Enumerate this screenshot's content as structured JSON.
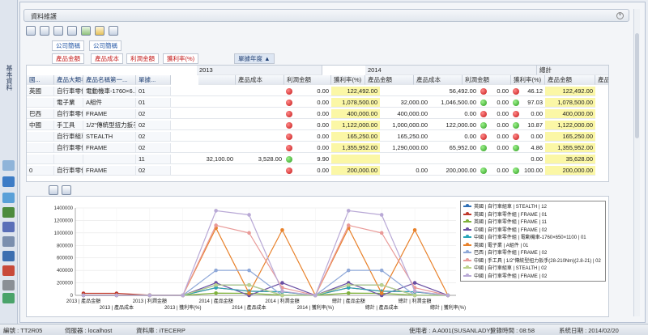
{
  "rail": {
    "tab_label": "基本資料"
  },
  "panel": {
    "title": "資料維護"
  },
  "filters": {
    "company_abbr": "公司簡稱",
    "company_code": "公司簡稱"
  },
  "data_fields": [
    "產品金額",
    "產品成本",
    "利潤金額",
    "獲利率(%)"
  ],
  "column_field": "單據年度",
  "row_fields": [
    "國...",
    "產品大類名...",
    "產品名稱第一...",
    "單據..."
  ],
  "years": [
    "2013",
    "2014"
  ],
  "total_label": "總計",
  "measure_headers": [
    "產品成本",
    "利潤金額",
    "獲利率(%)",
    "產品金額"
  ],
  "rows": [
    {
      "c0": "英國",
      "c1": "自行車零件組",
      "c2": "電動機車-1760×6...",
      "c3": "01",
      "y13": [
        "",
        "",
        "red",
        "0.00"
      ],
      "y14a": "122,492.00",
      "y14": [
        "",
        "56,492.00",
        "red",
        "0.00"
      ],
      "tot": [
        "",
        "",
        "red",
        "46.12"
      ],
      "tot_amt": "122,492.00"
    },
    {
      "c0": "",
      "c1": "電子業",
      "c2": "A組件",
      "c3": "01",
      "y13": [
        "",
        "",
        "red",
        "0.00"
      ],
      "y14a": "1,078,500.00",
      "y14": [
        "32,000.00",
        "1,046,500.00",
        "green",
        "0.00"
      ],
      "tot": [
        "",
        "",
        "green",
        "97.03"
      ],
      "tot_amt": "1,078,500.00"
    },
    {
      "c0": "巴西",
      "c1": "自行車零件組",
      "c2": "FRAME",
      "c3": "02",
      "y13": [
        "",
        "",
        "red",
        "0.00"
      ],
      "y14a": "400,000.00",
      "y14": [
        "400,000.00",
        "0.00",
        "red",
        "0.00"
      ],
      "tot": [
        "",
        "",
        "red",
        "0.00"
      ],
      "tot_amt": "400,000.00"
    },
    {
      "c0": "中國",
      "c1": "手工具",
      "c2": "1/2\"傳統型扭力扳手",
      "c3": "02",
      "y13": [
        "",
        "",
        "red",
        "0.00"
      ],
      "y14a": "1,122,000.00",
      "y14": [
        "1,000,000.00",
        "122,000.00",
        "green",
        "0.00"
      ],
      "tot": [
        "",
        "",
        "green",
        "10.87"
      ],
      "tot_amt": "1,122,000.00"
    },
    {
      "c0": "",
      "c1": "自行車組車",
      "c2": "STEALTH",
      "c3": "02",
      "y13": [
        "",
        "",
        "red",
        "0.00"
      ],
      "y14a": "165,250.00",
      "y14": [
        "165,250.00",
        "0.00",
        "red",
        "0.00"
      ],
      "tot": [
        "",
        "",
        "red",
        "0.00"
      ],
      "tot_amt": "165,250.00"
    },
    {
      "c0": "",
      "c1": "自行車零件組",
      "c2": "FRAME",
      "c3": "02",
      "y13": [
        "",
        "",
        "red",
        "0.00"
      ],
      "y14a": "1,355,952.00",
      "y14": [
        "1,290,000.00",
        "65,952.00",
        "green",
        "0.00"
      ],
      "tot": [
        "",
        "",
        "green",
        "4.86"
      ],
      "tot_amt": "1,355,952.00"
    },
    {
      "c0": "",
      "c1": "",
      "c2": "",
      "c3": "11",
      "y13": [
        "32,100.00",
        "3,528.00",
        "green",
        "9.90"
      ],
      "y14a": "",
      "y14": [
        "",
        "",
        "",
        ""
      ],
      "tot": [
        "",
        "",
        "",
        "0.00"
      ],
      "tot_amt": "35,628.00"
    },
    {
      "c0": "0",
      "c1": "自行車零件組",
      "c2": "FRAME",
      "c3": "02",
      "y13": [
        "",
        "",
        "red",
        "0.00"
      ],
      "y14a": "200,000.00",
      "y14": [
        "0.00",
        "200,000.00",
        "green",
        "0.00"
      ],
      "tot": [
        "",
        "",
        "green",
        "100.00"
      ],
      "tot_amt": "200,000.00"
    }
  ],
  "chart_data": {
    "type": "line",
    "categories": [
      "2013 | 產品金額",
      "2013 | 產品成本",
      "2013 | 利潤金額",
      "2013 | 獲利率(%)",
      "2014 | 產品金額",
      "2014 | 產品成本",
      "2014 | 利潤金額",
      "2014 | 獲利率(%)",
      "總計 | 產品金額",
      "總計 | 產品成本",
      "總計 | 利潤金額",
      "總計 | 獲利率(%)"
    ],
    "ylim": [
      0,
      1400000
    ],
    "yticks": [
      0,
      200000,
      400000,
      600000,
      800000,
      1000000,
      1200000,
      1400000
    ],
    "ytick_labels": [
      "0",
      "200000",
      "400000",
      "600000",
      "800000",
      "1000000",
      "1200000",
      "1400000"
    ],
    "series": [
      {
        "name": "英國 | 自行車組車 | STEALTH | 12",
        "color": "#2f6fb5",
        "values": [
          0,
          0,
          0,
          0,
          165250,
          165250,
          0,
          0,
          165250,
          165250,
          0,
          0
        ]
      },
      {
        "name": "英國 | 自行車零件組 | FRAME | 01",
        "color": "#c0392b",
        "values": [
          32100,
          32100,
          3528,
          10,
          122492,
          66000,
          56492,
          0,
          122492,
          66000,
          56492,
          46
        ]
      },
      {
        "name": "英國 | 自行車零件組 | FRAME | 11",
        "color": "#7fb13a",
        "values": [
          0,
          0,
          0,
          0,
          35628,
          32100,
          3528,
          10,
          35628,
          32100,
          3528,
          10
        ]
      },
      {
        "name": "中國 | 自行車零件組 | FRAME | 02",
        "color": "#6a4fa3",
        "values": [
          0,
          0,
          0,
          0,
          200000,
          0,
          200000,
          100,
          200000,
          0,
          200000,
          100
        ]
      },
      {
        "name": "中國 | 自行車零件組 | 電動機車-1760×650×1100 | 01",
        "color": "#27a5b8",
        "values": [
          0,
          0,
          0,
          0,
          122492,
          66000,
          56492,
          0,
          122492,
          66000,
          56492,
          46
        ]
      },
      {
        "name": "英國 | 電子業 | A組件 | 01",
        "color": "#e8812a",
        "values": [
          0,
          0,
          0,
          0,
          1078500,
          32000,
          1046500,
          97,
          1078500,
          32000,
          1046500,
          97
        ]
      },
      {
        "name": "巴西 | 自行車零件組 | FRAME | 02",
        "color": "#8fa8d8",
        "values": [
          0,
          0,
          0,
          0,
          400000,
          400000,
          0,
          0,
          400000,
          400000,
          0,
          0
        ]
      },
      {
        "name": "中國 | 手工具 | 1/2\"傳統型扭力扳手(28-210Nm)(2.8-21) | 02",
        "color": "#e99a98",
        "values": [
          0,
          0,
          0,
          0,
          1122000,
          1000000,
          122000,
          11,
          1122000,
          1000000,
          122000,
          11
        ]
      },
      {
        "name": "中國 | 自行車組車 | STEALTH | 02",
        "color": "#bcd18b",
        "values": [
          0,
          0,
          0,
          0,
          165250,
          165250,
          0,
          0,
          165250,
          165250,
          0,
          0
        ]
      },
      {
        "name": "中國 | 自行車零件組 | FRAME | 02",
        "color": "#b9a9d6",
        "values": [
          0,
          0,
          0,
          0,
          1355952,
          1290000,
          65952,
          5,
          1355952,
          1290000,
          65952,
          5
        ]
      }
    ]
  },
  "status": {
    "s1": "編號 : TT2R05",
    "s2": "伺服器 : localhost",
    "s3": "資料庫 : iTECERP",
    "s4": "使用者 : A A001(SUSANLADY)",
    "s5": "登錄時間 : 08:58",
    "s6": "系統日期 : 2014/02/20"
  }
}
